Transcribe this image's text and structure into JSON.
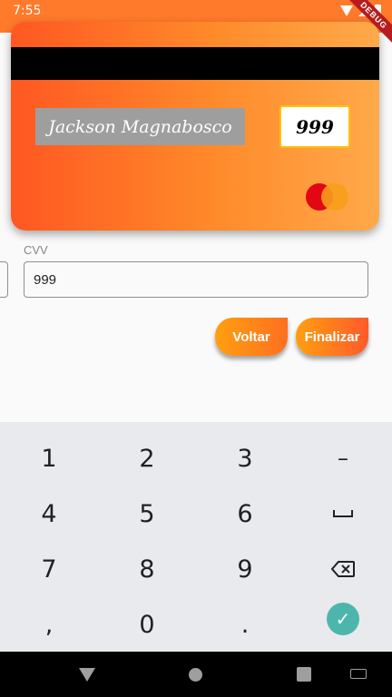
{
  "status_bar": {
    "time": "7:55"
  },
  "debug_banner": "DEBUG",
  "card": {
    "holder_name": "Jackson Magnabosco",
    "cvv": "999",
    "brand": "mastercard-logo"
  },
  "form": {
    "cvv_label": "CVV",
    "cvv_value": "999"
  },
  "buttons": {
    "back_label": "Voltar",
    "finish_label": "Finalizar"
  },
  "keyboard": {
    "rows": [
      [
        "1",
        "2",
        "3",
        "–"
      ],
      [
        "4",
        "5",
        "6",
        "space"
      ],
      [
        "7",
        "8",
        "9",
        "backspace"
      ],
      [
        ",",
        "0",
        ".",
        "enter"
      ]
    ]
  },
  "colors": {
    "card_gradient_start": "#ff5722",
    "card_gradient_end": "#ffa94a",
    "accent": "#ff9f10",
    "enter_key": "#4db6ac"
  }
}
